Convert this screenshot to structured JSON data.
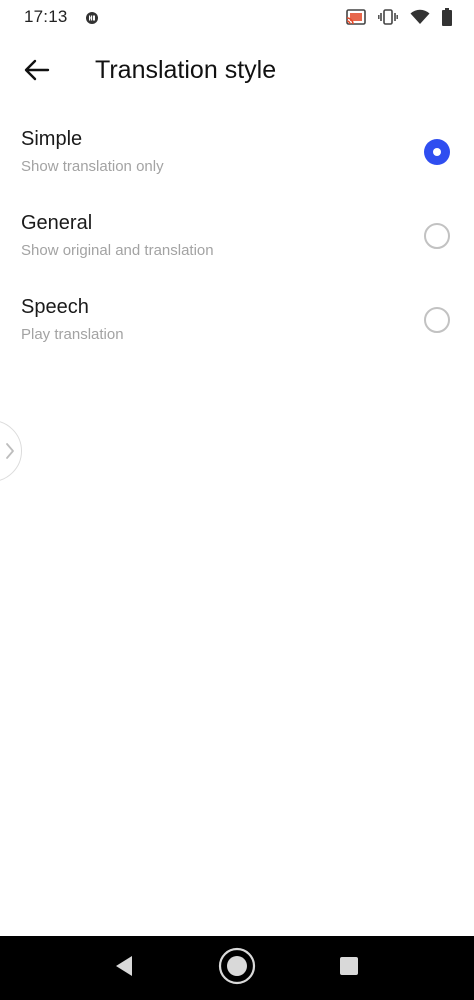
{
  "status_bar": {
    "time": "17:13",
    "icons": [
      "hd-icon",
      "cast-icon",
      "vibrate-icon",
      "wifi-icon",
      "battery-icon"
    ]
  },
  "header": {
    "back_icon": "arrow-left-icon",
    "title": "Translation style"
  },
  "options": [
    {
      "title": "Simple",
      "subtitle": "Show translation only",
      "selected": true
    },
    {
      "title": "General",
      "subtitle": "Show original and translation",
      "selected": false
    },
    {
      "title": "Speech",
      "subtitle": "Play translation",
      "selected": false
    }
  ],
  "edge_handle": {
    "icon": "chevron-right-icon"
  },
  "nav_bar": {
    "buttons": [
      "back-triangle-icon",
      "home-circle-icon",
      "recents-square-icon"
    ]
  },
  "colors": {
    "accent": "#2f4ef0",
    "radio_unchecked": "#c2c2c2",
    "subtitle": "#a3a3a3",
    "nav_background": "#000000"
  }
}
